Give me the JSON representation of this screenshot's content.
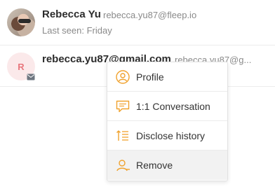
{
  "contacts": [
    {
      "name": "Rebecca Yu",
      "email": "rebecca.yu87@fleep.io",
      "status": "Last seen: Friday"
    },
    {
      "avatar_letter": "R",
      "name": "rebecca.yu87@gmail.com",
      "email": "rebecca.yu87@g..."
    }
  ],
  "context_menu": {
    "items": [
      {
        "label": "Profile",
        "icon": "profile-icon"
      },
      {
        "label": "1:1 Conversation",
        "icon": "chat-bubble-icon"
      },
      {
        "label": "Disclose history",
        "icon": "disclose-history-icon"
      },
      {
        "label": "Remove",
        "icon": "remove-user-icon"
      }
    ]
  },
  "colors": {
    "icon_accent": "#f0a22e",
    "avatar_letter_bg": "#fbe9ea",
    "avatar_letter_fg": "#e8777d",
    "hover_bg": "#f2f2f2"
  }
}
